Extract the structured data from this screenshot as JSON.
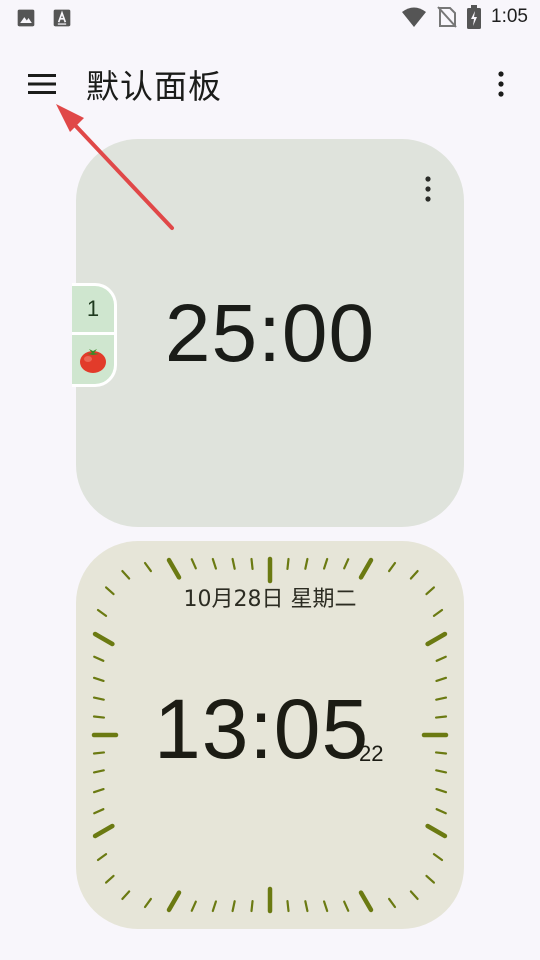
{
  "status_bar": {
    "time": "1:05",
    "icons": [
      "image-icon",
      "a-font-icon",
      "wifi-icon",
      "no-sim-icon",
      "battery-charging-icon"
    ]
  },
  "app_bar": {
    "title": "默认面板",
    "menu_icon": "hamburger-menu-icon",
    "overflow_icon": "more-vert-icon"
  },
  "pomodoro_card": {
    "time": "25:00",
    "count": "1",
    "tomato_icon": "tomato-icon",
    "menu_icon": "more-vert-icon"
  },
  "clock_card": {
    "date": "10月28日 星期二",
    "time": "13:05",
    "seconds": "22"
  },
  "colors": {
    "background": "#f8f6fb",
    "pomodoro_card": "#dfe3dc",
    "clock_card": "#e6e5d8",
    "tick": "#6b7a12",
    "annotation_arrow": "#e04848"
  }
}
